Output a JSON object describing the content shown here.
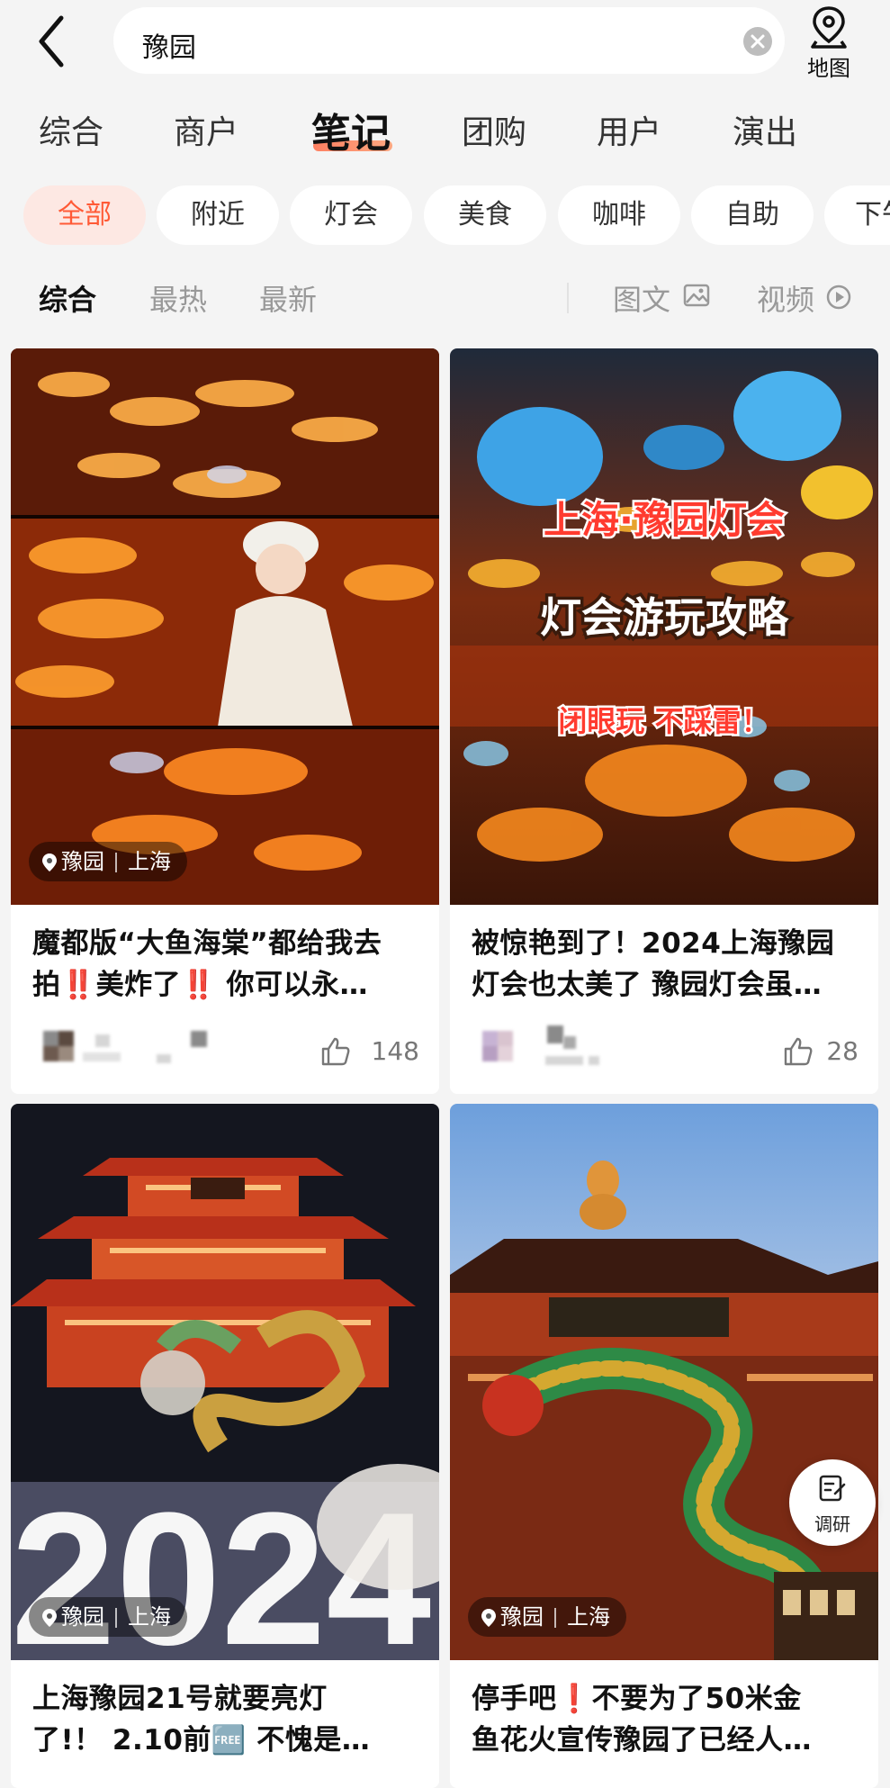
{
  "search": {
    "query": "豫园",
    "map_label": "地图"
  },
  "main_tabs": [
    "综合",
    "商户",
    "笔记",
    "团购",
    "用户",
    "演出"
  ],
  "active_main_tab": "笔记",
  "filter_chips": [
    "全部",
    "附近",
    "灯会",
    "美食",
    "咖啡",
    "自助",
    "下午茶"
  ],
  "active_chip": "全部",
  "sort_tabs": [
    "综合",
    "最热",
    "最新"
  ],
  "active_sort": "综合",
  "content_types": [
    "图文",
    "视频"
  ],
  "cards": [
    {
      "image_desc": "lantern-festival-photo-collage",
      "location": {
        "place": "豫园",
        "city": "上海"
      },
      "title_lines": [
        "魔都版“大鱼海棠”都给我去",
        "拍‼️美炸了‼️ 你可以永…"
      ],
      "likes": "148",
      "overlay": null
    },
    {
      "image_desc": "lantern-festival-poster",
      "location": null,
      "overlay": {
        "line1": "上海·豫园灯会",
        "line2": "灯会游玩攻略",
        "line3": "闭眼玩 不踩雷！"
      },
      "title_lines": [
        "被惊艳到了！2024上海豫园",
        "灯会也太美了 豫园灯会虽…"
      ],
      "likes": "28"
    },
    {
      "image_desc": "pagoda-with-dragon-2024",
      "location": {
        "place": "豫园",
        "city": "上海"
      },
      "overlay": {
        "year": "2024"
      },
      "title_lines": [
        "上海豫园21号就要亮灯",
        "了!！ 2.10前🆓 不愧是…"
      ],
      "likes": null
    },
    {
      "image_desc": "dragon-lantern-in-front-of-pavilion",
      "location": {
        "place": "豫园",
        "city": "上海"
      },
      "overlay": null,
      "title_lines": [
        "停手吧❗️不要为了50米金",
        "鱼花火宣传豫园了已经人…"
      ],
      "likes": null
    }
  ],
  "float_button": {
    "label": "调研",
    "icon": "edit-note-icon"
  },
  "colors": {
    "accent": "#ff5a36",
    "chip_active_bg": "#fde8e3",
    "page_bg": "#f4f4f4"
  }
}
